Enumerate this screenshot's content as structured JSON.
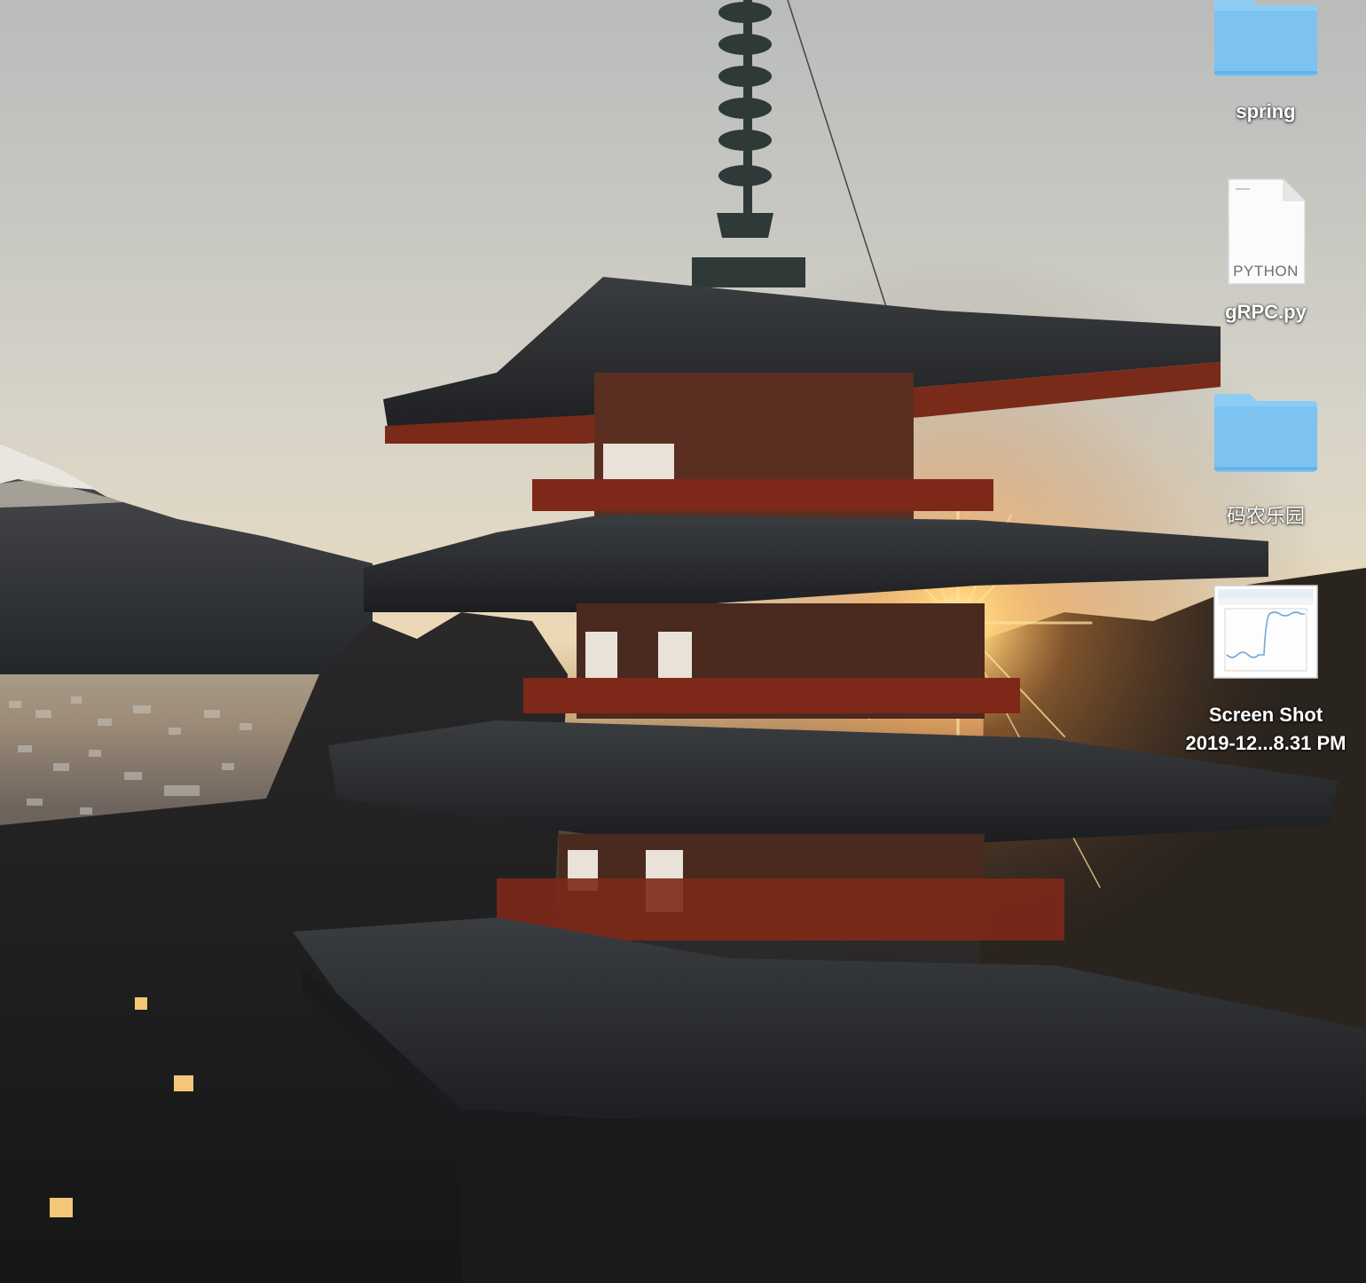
{
  "desktop": {
    "icons": [
      {
        "label": "spring",
        "kind": "folder",
        "icon": "folder-icon"
      },
      {
        "label": "gRPC.py",
        "kind": "file",
        "icon": "python-file-icon",
        "badge": "PYTHON"
      },
      {
        "label": "码农乐园",
        "kind": "folder",
        "icon": "folder-icon"
      },
      {
        "label_line1": "Screen Shot",
        "label_line2": "2019-12...8.31 PM",
        "kind": "image",
        "icon": "screenshot-thumbnail-icon"
      }
    ]
  },
  "colors": {
    "folder": "#7cc3f2",
    "folder_tab": "#8ccdf6",
    "folder_shade": "#5aa9e0",
    "label_text": "#ffffff"
  }
}
